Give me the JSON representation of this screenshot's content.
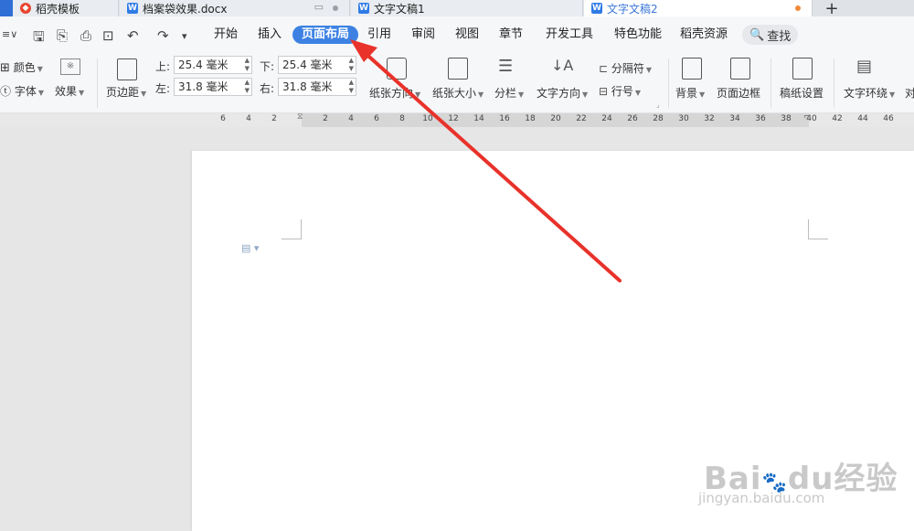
{
  "tabs": [
    {
      "label": "稻壳模板"
    },
    {
      "label": "档案袋效果.docx"
    },
    {
      "label": "文字文稿1"
    },
    {
      "label": "文字文稿2"
    }
  ],
  "new_tab_label": "+",
  "menu": {
    "items": [
      "开始",
      "插入",
      "页面布局",
      "引用",
      "审阅",
      "视图",
      "章节",
      "开发工具",
      "特色功能",
      "稻壳资源"
    ],
    "active": "页面布局",
    "search_label": "查找"
  },
  "ribbon": {
    "color_label": "颜色",
    "font_label": "字体",
    "effect_label": "效果",
    "margin_label": "页边距",
    "top_label": "上:",
    "top_value": "25.4 毫米",
    "bottom_label": "下:",
    "bottom_value": "25.4 毫米",
    "left_label": "左:",
    "left_value": "31.8 毫米",
    "right_label": "右:",
    "right_value": "31.8 毫米",
    "orientation_label": "纸张方向",
    "size_label": "纸张大小",
    "columns_label": "分栏",
    "text_direction_label": "文字方向",
    "breaks_label": "分隔符",
    "line_numbers_label": "行号",
    "background_label": "背景",
    "page_border_label": "页面边框",
    "manuscript_label": "稿纸设置",
    "text_wrap_label": "文字环绕",
    "align_label": "对"
  },
  "ruler": {
    "ticks": [
      "6",
      "4",
      "2",
      "2",
      "4",
      "6",
      "8",
      "10",
      "12",
      "14",
      "16",
      "18",
      "20",
      "22",
      "24",
      "26",
      "28",
      "30",
      "32",
      "34",
      "36",
      "38",
      "40",
      "42",
      "44",
      "46"
    ]
  },
  "watermark": {
    "brand": "Bai",
    "brand_mid": "du",
    "brand_cn": "经验",
    "url": "jingyan.baidu.com"
  },
  "colors": {
    "accent": "#3d82e3",
    "arrow": "#e8322a"
  }
}
